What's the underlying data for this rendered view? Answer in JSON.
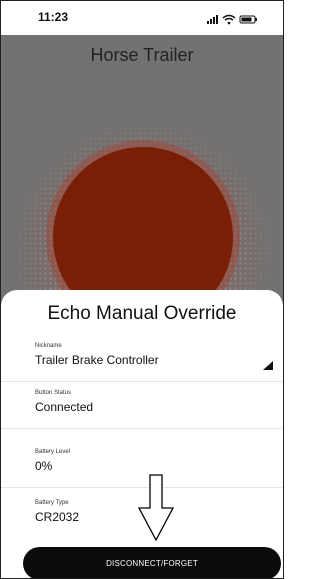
{
  "status_bar": {
    "time": "11:23"
  },
  "device": {
    "title": "Horse Trailer",
    "circle_color": "#7a1f05"
  },
  "sheet": {
    "title": "Echo Manual Override",
    "fields": [
      {
        "label": "Nickname",
        "value": "Trailer Brake Controller"
      },
      {
        "label": "Button Status",
        "value": "Connected"
      },
      {
        "label": "Battery Level",
        "value": "0%"
      },
      {
        "label": "Battery Type",
        "value": "CR2032"
      }
    ],
    "disconnect_label": "DISCONNECT/FORGET"
  },
  "icons": {
    "signal": "signal-bars-icon",
    "wifi": "wifi-icon",
    "battery": "battery-icon",
    "dropdown": "dropdown-triangle-icon",
    "annotation_arrow": "down-arrow-icon"
  },
  "colors": {
    "backdrop": "#727272",
    "button": "#0b0b0b"
  }
}
